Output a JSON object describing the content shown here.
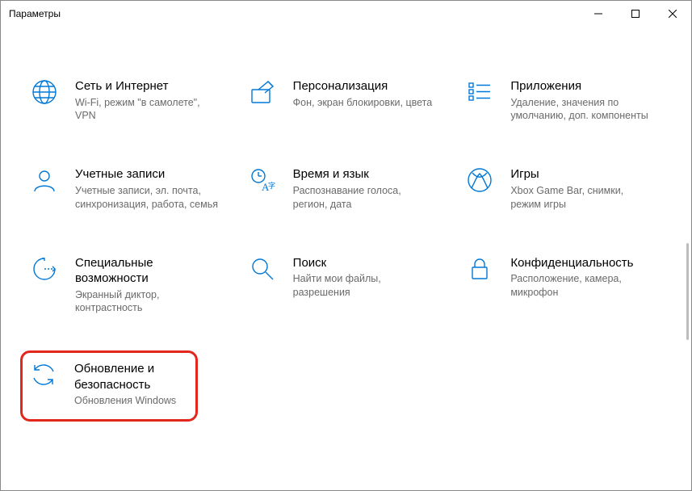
{
  "window": {
    "title": "Параметры"
  },
  "tiles": {
    "network": {
      "title": "Сеть и Интернет",
      "desc": "Wi-Fi, режим \"в самолете\", VPN"
    },
    "personalization": {
      "title": "Персонализация",
      "desc": "Фон, экран блокировки, цвета"
    },
    "apps": {
      "title": "Приложения",
      "desc": "Удаление, значения по умолчанию, доп. компоненты"
    },
    "accounts": {
      "title": "Учетные записи",
      "desc": "Учетные записи, эл. почта, синхронизация, работа, семья"
    },
    "timelang": {
      "title": "Время и язык",
      "desc": "Распознавание голоса, регион, дата"
    },
    "gaming": {
      "title": "Игры",
      "desc": "Xbox Game Bar, снимки, режим игры"
    },
    "ease": {
      "title": "Специальные возможности",
      "desc": "Экранный диктор, контрастность"
    },
    "search": {
      "title": "Поиск",
      "desc": "Найти мои файлы, разрешения"
    },
    "privacy": {
      "title": "Конфиденциальность",
      "desc": "Расположение, камера, микрофон"
    },
    "update": {
      "title": "Обновление и безопасность",
      "desc": "Обновления Windows"
    }
  }
}
